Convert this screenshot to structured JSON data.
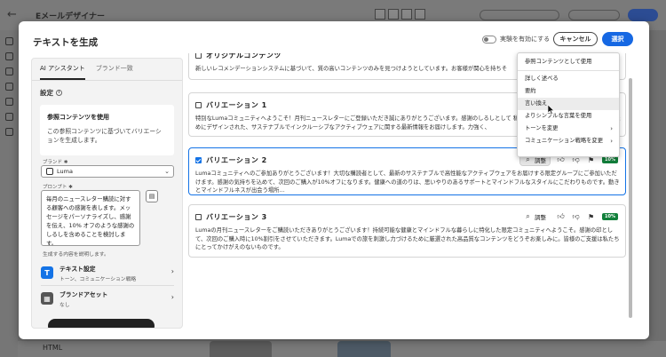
{
  "background": {
    "app_title": "Eメールデザイナー",
    "bottom_label": "HTML"
  },
  "modal": {
    "title": "テキストを生成",
    "experiment_label": "実験を有効にする",
    "cancel_label": "キャンセル",
    "select_label": "選択"
  },
  "left": {
    "tabs": [
      "AI アシスタント",
      "ブランド一致"
    ],
    "settings_title": "設定",
    "reference_card": {
      "title": "参照コンテンツを使用",
      "description": "この参照コンテンツに基づいてバリエーションを生成します。"
    },
    "brand_label": "ブランド",
    "brand_value": "Luma",
    "prompt_label": "プロンプト",
    "prompt_text": "毎月のニュースレター購読に対する顧客への感謝を表します。メッセージをパーソナライズし、感謝を伝え、10% オフのような感謝のしるしを含めることを検討します。",
    "prompt_help": "生成する内容を説明します。",
    "text_settings": {
      "title": "テキスト設定",
      "sub": "トーン、コミュニケーション戦略"
    },
    "brand_assets": {
      "title": "ブランドアセット",
      "sub": "なし"
    }
  },
  "cards": [
    {
      "title": "オリジナルコンテンツ",
      "body": "新しいレコメンデーションシステムに基づいて、質の高いコンテンツのみを見つけようとしています。お客様が関心を持ちそ"
    },
    {
      "title": "バリエーション 1",
      "body": "特別なLumaコミュニティへようこそ！月刊ニュースレターにご登録いただき誠にありがとうございます。感謝のしるしとして 私たちと一緒に ものです。あなただけのためにデザインされた、サステナブルでインクルーシブなアクティブウェアに関する最新情報をお届けします。力強く、"
    },
    {
      "title": "バリエーション 2",
      "body": "Lumaコミュニティへのご参加ありがとうございます！大切な購読者として、最新のサステナブルで高性能なアクティブウェアをお届けする限定グループにご参加いただけます。感謝の気持ちを込めて、次回のご購入が10%オフになります。健康への道のりは、思いやりのあるサポートとマインドフルなスタイルにこだわりものです。動きとマインドフルネスが出会う場所…",
      "refine_label": "調整",
      "score": "10%"
    },
    {
      "title": "バリエーション 3",
      "body": "Lumaの月刊ニュースレターをご購読いただきありがとうございます！持続可能な健康とマインドフルな暮らしに特化した限定コミュニティへようこそ。感謝の印として、次回のご購入時に10%割引をさせていただきます。Lumaでの旅を刺激し力づけるために厳選された高品質なコンテンツをどうぞお楽しみに。皆様のご支援は私たちにとってかけがえのないものです。",
      "refine_label": "調整",
      "score": "10%"
    }
  ],
  "menu": {
    "items": [
      {
        "label": "参照コンテンツとして使用",
        "has_sub": false
      },
      {
        "label": "詳しく述べる",
        "has_sub": false
      },
      {
        "label": "要約",
        "has_sub": false
      },
      {
        "label": "言い換え",
        "has_sub": false
      },
      {
        "label": "よりシンプルな言葉を使用",
        "has_sub": false
      },
      {
        "label": "トーンを変更",
        "has_sub": true
      },
      {
        "label": "コミュニケーション戦略を変更",
        "has_sub": true
      }
    ]
  },
  "colors": {
    "accent": "#1473e6",
    "score_green": "#12803b"
  }
}
